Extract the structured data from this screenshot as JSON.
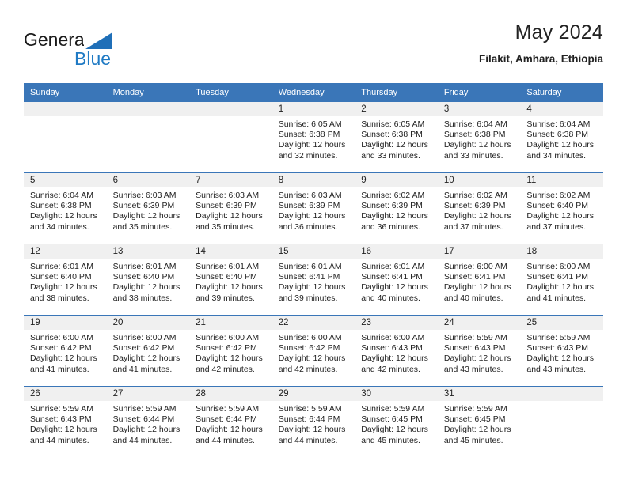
{
  "brand": {
    "name_top": "General",
    "name_bottom": "Blue",
    "top_color": "#1a1a1a",
    "bottom_color": "#1f7ac4",
    "triangle_color": "#1f6fb8",
    "icon": "generalblue-logo"
  },
  "header": {
    "title": "May 2024",
    "subtitle": "Filakit, Amhara, Ethiopia"
  },
  "colors": {
    "header_row_bg": "#3a76b8",
    "header_row_text": "#ffffff",
    "day_number_bg": "#f0f0f0",
    "cell_bg": "#ffffff",
    "grid_line": "#3a76b8",
    "text": "#222222"
  },
  "weekday_headers": [
    "Sunday",
    "Monday",
    "Tuesday",
    "Wednesday",
    "Thursday",
    "Friday",
    "Saturday"
  ],
  "labels": {
    "sunrise": "Sunrise:",
    "sunset": "Sunset:",
    "daylight": "Daylight:"
  },
  "weeks": [
    [
      {
        "day": "",
        "sunrise": "",
        "sunset": "",
        "daylight_line1": "",
        "daylight_line2": "",
        "empty": true
      },
      {
        "day": "",
        "sunrise": "",
        "sunset": "",
        "daylight_line1": "",
        "daylight_line2": "",
        "empty": true
      },
      {
        "day": "",
        "sunrise": "",
        "sunset": "",
        "daylight_line1": "",
        "daylight_line2": "",
        "empty": true
      },
      {
        "day": "1",
        "sunrise": "Sunrise: 6:05 AM",
        "sunset": "Sunset: 6:38 PM",
        "daylight_line1": "Daylight: 12 hours",
        "daylight_line2": "and 32 minutes.",
        "empty": false
      },
      {
        "day": "2",
        "sunrise": "Sunrise: 6:05 AM",
        "sunset": "Sunset: 6:38 PM",
        "daylight_line1": "Daylight: 12 hours",
        "daylight_line2": "and 33 minutes.",
        "empty": false
      },
      {
        "day": "3",
        "sunrise": "Sunrise: 6:04 AM",
        "sunset": "Sunset: 6:38 PM",
        "daylight_line1": "Daylight: 12 hours",
        "daylight_line2": "and 33 minutes.",
        "empty": false
      },
      {
        "day": "4",
        "sunrise": "Sunrise: 6:04 AM",
        "sunset": "Sunset: 6:38 PM",
        "daylight_line1": "Daylight: 12 hours",
        "daylight_line2": "and 34 minutes.",
        "empty": false
      }
    ],
    [
      {
        "day": "5",
        "sunrise": "Sunrise: 6:04 AM",
        "sunset": "Sunset: 6:38 PM",
        "daylight_line1": "Daylight: 12 hours",
        "daylight_line2": "and 34 minutes.",
        "empty": false
      },
      {
        "day": "6",
        "sunrise": "Sunrise: 6:03 AM",
        "sunset": "Sunset: 6:39 PM",
        "daylight_line1": "Daylight: 12 hours",
        "daylight_line2": "and 35 minutes.",
        "empty": false
      },
      {
        "day": "7",
        "sunrise": "Sunrise: 6:03 AM",
        "sunset": "Sunset: 6:39 PM",
        "daylight_line1": "Daylight: 12 hours",
        "daylight_line2": "and 35 minutes.",
        "empty": false
      },
      {
        "day": "8",
        "sunrise": "Sunrise: 6:03 AM",
        "sunset": "Sunset: 6:39 PM",
        "daylight_line1": "Daylight: 12 hours",
        "daylight_line2": "and 36 minutes.",
        "empty": false
      },
      {
        "day": "9",
        "sunrise": "Sunrise: 6:02 AM",
        "sunset": "Sunset: 6:39 PM",
        "daylight_line1": "Daylight: 12 hours",
        "daylight_line2": "and 36 minutes.",
        "empty": false
      },
      {
        "day": "10",
        "sunrise": "Sunrise: 6:02 AM",
        "sunset": "Sunset: 6:39 PM",
        "daylight_line1": "Daylight: 12 hours",
        "daylight_line2": "and 37 minutes.",
        "empty": false
      },
      {
        "day": "11",
        "sunrise": "Sunrise: 6:02 AM",
        "sunset": "Sunset: 6:40 PM",
        "daylight_line1": "Daylight: 12 hours",
        "daylight_line2": "and 37 minutes.",
        "empty": false
      }
    ],
    [
      {
        "day": "12",
        "sunrise": "Sunrise: 6:01 AM",
        "sunset": "Sunset: 6:40 PM",
        "daylight_line1": "Daylight: 12 hours",
        "daylight_line2": "and 38 minutes.",
        "empty": false
      },
      {
        "day": "13",
        "sunrise": "Sunrise: 6:01 AM",
        "sunset": "Sunset: 6:40 PM",
        "daylight_line1": "Daylight: 12 hours",
        "daylight_line2": "and 38 minutes.",
        "empty": false
      },
      {
        "day": "14",
        "sunrise": "Sunrise: 6:01 AM",
        "sunset": "Sunset: 6:40 PM",
        "daylight_line1": "Daylight: 12 hours",
        "daylight_line2": "and 39 minutes.",
        "empty": false
      },
      {
        "day": "15",
        "sunrise": "Sunrise: 6:01 AM",
        "sunset": "Sunset: 6:41 PM",
        "daylight_line1": "Daylight: 12 hours",
        "daylight_line2": "and 39 minutes.",
        "empty": false
      },
      {
        "day": "16",
        "sunrise": "Sunrise: 6:01 AM",
        "sunset": "Sunset: 6:41 PM",
        "daylight_line1": "Daylight: 12 hours",
        "daylight_line2": "and 40 minutes.",
        "empty": false
      },
      {
        "day": "17",
        "sunrise": "Sunrise: 6:00 AM",
        "sunset": "Sunset: 6:41 PM",
        "daylight_line1": "Daylight: 12 hours",
        "daylight_line2": "and 40 minutes.",
        "empty": false
      },
      {
        "day": "18",
        "sunrise": "Sunrise: 6:00 AM",
        "sunset": "Sunset: 6:41 PM",
        "daylight_line1": "Daylight: 12 hours",
        "daylight_line2": "and 41 minutes.",
        "empty": false
      }
    ],
    [
      {
        "day": "19",
        "sunrise": "Sunrise: 6:00 AM",
        "sunset": "Sunset: 6:42 PM",
        "daylight_line1": "Daylight: 12 hours",
        "daylight_line2": "and 41 minutes.",
        "empty": false
      },
      {
        "day": "20",
        "sunrise": "Sunrise: 6:00 AM",
        "sunset": "Sunset: 6:42 PM",
        "daylight_line1": "Daylight: 12 hours",
        "daylight_line2": "and 41 minutes.",
        "empty": false
      },
      {
        "day": "21",
        "sunrise": "Sunrise: 6:00 AM",
        "sunset": "Sunset: 6:42 PM",
        "daylight_line1": "Daylight: 12 hours",
        "daylight_line2": "and 42 minutes.",
        "empty": false
      },
      {
        "day": "22",
        "sunrise": "Sunrise: 6:00 AM",
        "sunset": "Sunset: 6:42 PM",
        "daylight_line1": "Daylight: 12 hours",
        "daylight_line2": "and 42 minutes.",
        "empty": false
      },
      {
        "day": "23",
        "sunrise": "Sunrise: 6:00 AM",
        "sunset": "Sunset: 6:43 PM",
        "daylight_line1": "Daylight: 12 hours",
        "daylight_line2": "and 42 minutes.",
        "empty": false
      },
      {
        "day": "24",
        "sunrise": "Sunrise: 5:59 AM",
        "sunset": "Sunset: 6:43 PM",
        "daylight_line1": "Daylight: 12 hours",
        "daylight_line2": "and 43 minutes.",
        "empty": false
      },
      {
        "day": "25",
        "sunrise": "Sunrise: 5:59 AM",
        "sunset": "Sunset: 6:43 PM",
        "daylight_line1": "Daylight: 12 hours",
        "daylight_line2": "and 43 minutes.",
        "empty": false
      }
    ],
    [
      {
        "day": "26",
        "sunrise": "Sunrise: 5:59 AM",
        "sunset": "Sunset: 6:43 PM",
        "daylight_line1": "Daylight: 12 hours",
        "daylight_line2": "and 44 minutes.",
        "empty": false
      },
      {
        "day": "27",
        "sunrise": "Sunrise: 5:59 AM",
        "sunset": "Sunset: 6:44 PM",
        "daylight_line1": "Daylight: 12 hours",
        "daylight_line2": "and 44 minutes.",
        "empty": false
      },
      {
        "day": "28",
        "sunrise": "Sunrise: 5:59 AM",
        "sunset": "Sunset: 6:44 PM",
        "daylight_line1": "Daylight: 12 hours",
        "daylight_line2": "and 44 minutes.",
        "empty": false
      },
      {
        "day": "29",
        "sunrise": "Sunrise: 5:59 AM",
        "sunset": "Sunset: 6:44 PM",
        "daylight_line1": "Daylight: 12 hours",
        "daylight_line2": "and 44 minutes.",
        "empty": false
      },
      {
        "day": "30",
        "sunrise": "Sunrise: 5:59 AM",
        "sunset": "Sunset: 6:45 PM",
        "daylight_line1": "Daylight: 12 hours",
        "daylight_line2": "and 45 minutes.",
        "empty": false
      },
      {
        "day": "31",
        "sunrise": "Sunrise: 5:59 AM",
        "sunset": "Sunset: 6:45 PM",
        "daylight_line1": "Daylight: 12 hours",
        "daylight_line2": "and 45 minutes.",
        "empty": false
      },
      {
        "day": "",
        "sunrise": "",
        "sunset": "",
        "daylight_line1": "",
        "daylight_line2": "",
        "empty": true
      }
    ]
  ]
}
